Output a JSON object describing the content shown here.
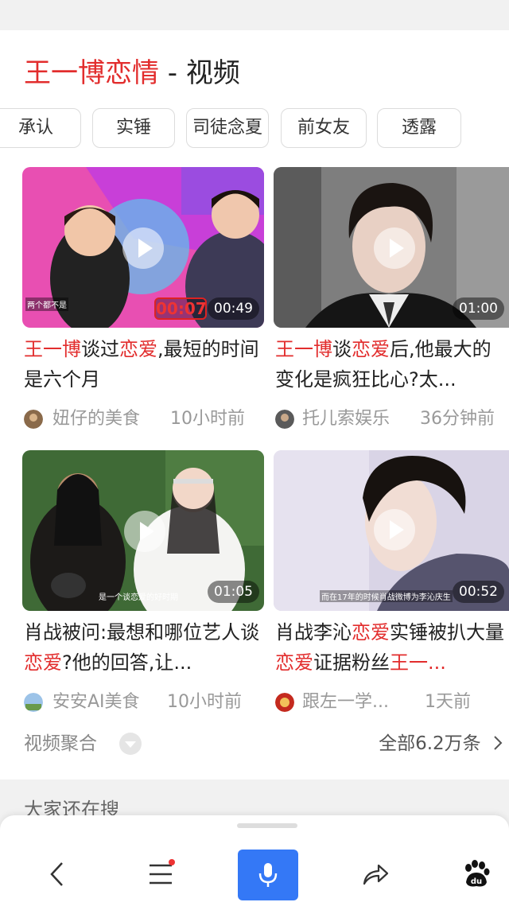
{
  "header": {
    "title_highlight": "王一博恋情",
    "title_rest": " - 视频"
  },
  "chips": [
    "承认",
    "实锤",
    "司徒念夏",
    "前女友",
    "透露"
  ],
  "videos": [
    {
      "duration": "00:49",
      "title_parts": [
        {
          "text": "王一博",
          "hl": true
        },
        {
          "text": "谈过",
          "hl": false
        },
        {
          "text": "恋爱",
          "hl": true
        },
        {
          "text": ",最短的时间是六个月",
          "hl": false
        }
      ],
      "author": "妞仔的美食",
      "time": "10小时前",
      "thumb_caption": "两个都不是",
      "timer_overlay": "00:07"
    },
    {
      "duration": "01:00",
      "title_parts": [
        {
          "text": "王一博",
          "hl": true
        },
        {
          "text": "谈",
          "hl": false
        },
        {
          "text": "恋爱",
          "hl": true
        },
        {
          "text": "后,他最大的变化是疯狂比心?太...",
          "hl": false
        }
      ],
      "author": "托儿索娱乐",
      "time": "36分钟前"
    },
    {
      "duration": "01:05",
      "title_parts": [
        {
          "text": "肖战被问:最想和哪位艺人谈",
          "hl": false
        },
        {
          "text": "恋爱",
          "hl": true
        },
        {
          "text": "?他的回答,让...",
          "hl": false
        }
      ],
      "author": "安安AI美食",
      "time": "10小时前",
      "thumb_caption": "是一个谈恋爱的好时期"
    },
    {
      "duration": "00:52",
      "title_parts": [
        {
          "text": "肖战李沁",
          "hl": false
        },
        {
          "text": "恋爱",
          "hl": true
        },
        {
          "text": "实锤被扒大量",
          "hl": false
        },
        {
          "text": "恋爱",
          "hl": true
        },
        {
          "text": "证据粉丝",
          "hl": false
        },
        {
          "text": "王一...",
          "hl": true
        }
      ],
      "author": "跟左一学...",
      "time": "1天前",
      "thumb_caption": "而在17年的时候肖战微博为李沁庆生"
    }
  ],
  "footer": {
    "aggregate_label": "视频聚合",
    "total_label": "全部6.2万条",
    "also_search": "大家还在搜"
  },
  "bottom_nav": {
    "items": [
      "back-icon",
      "menu-icon",
      "microphone-icon",
      "share-icon",
      "baidu-paw-icon"
    ],
    "accent_color": "#3478f6"
  },
  "colors": {
    "highlight": "#e22d2d",
    "meta": "#999999"
  }
}
